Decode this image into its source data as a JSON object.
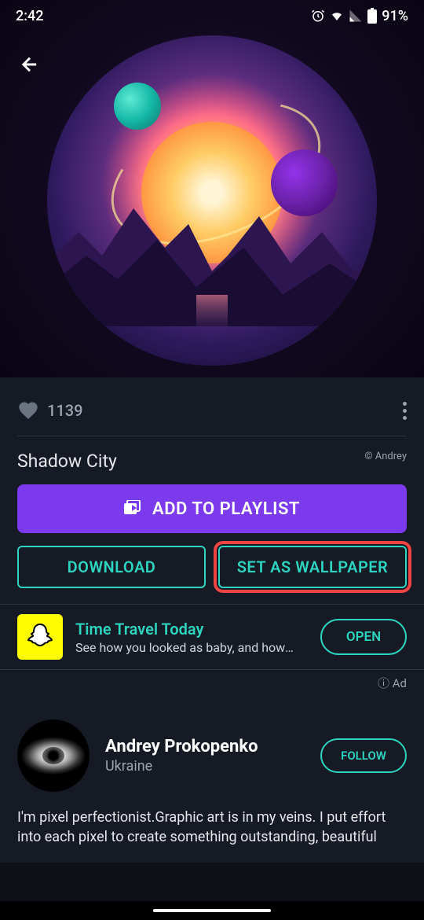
{
  "status": {
    "time": "2:42",
    "battery": "91%"
  },
  "wallpaper": {
    "like_count": "1139",
    "title": "Shadow City",
    "copyright": "© Andrey"
  },
  "buttons": {
    "add_to_playlist": "ADD TO PLAYLIST",
    "download": "DOWNLOAD",
    "set_wallpaper": "SET AS WALLPAPER"
  },
  "ad": {
    "title": "Time Travel Today",
    "description": "See how you looked as baby, and how y…",
    "cta": "OPEN",
    "label": "ⓘ Ad"
  },
  "author": {
    "name": "Andrey Prokopenko",
    "location": "Ukraine",
    "follow": "FOLLOW",
    "bio": "I'm pixel perfectionist.Graphic art is in my veins. I put effort into each pixel to create something outstanding, beautiful"
  }
}
